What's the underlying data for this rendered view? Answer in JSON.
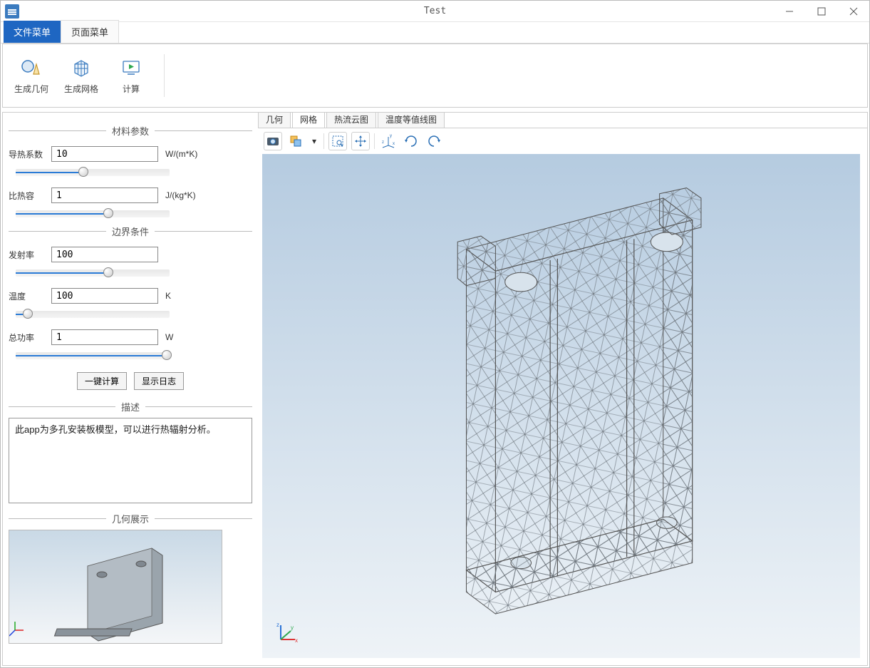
{
  "titlebar": {
    "title": "Test"
  },
  "ribbon": {
    "tabs": [
      {
        "label": "文件菜单",
        "active": true
      },
      {
        "label": "页面菜单",
        "active": false
      }
    ],
    "buttons": {
      "gen_geometry": "生成几何",
      "gen_mesh": "生成网格",
      "compute": "计算"
    }
  },
  "sidebar": {
    "sections": {
      "material": "材料参数",
      "boundary": "边界条件",
      "description": "描述",
      "preview": "几何展示"
    },
    "params": {
      "thermal_conductivity": {
        "label": "导热系数",
        "value": "10",
        "unit": "W/(m*K)",
        "slider_pct": 44
      },
      "specific_heat": {
        "label": "比热容",
        "value": "1",
        "unit": "J/(kg*K)",
        "slider_pct": 60
      },
      "emissivity": {
        "label": "发射率",
        "value": "100",
        "unit": "",
        "slider_pct": 60
      },
      "temperature": {
        "label": "温度",
        "value": "100",
        "unit": "K",
        "slider_pct": 8
      },
      "total_power": {
        "label": "总功率",
        "value": "1",
        "unit": "W",
        "slider_pct": 98
      }
    },
    "actions": {
      "one_click_compute": "一键计算",
      "show_log": "显示日志"
    },
    "description_text": "此app为多孔安装板模型，可以进行热辐射分析。"
  },
  "viewport": {
    "tabs": [
      {
        "label": "几何"
      },
      {
        "label": "网格",
        "active": true
      },
      {
        "label": "热流云图"
      },
      {
        "label": "温度等值线图"
      }
    ],
    "toolbar_icons": [
      "camera-icon",
      "box-select-icon",
      "dropdown-icon",
      "zoom-box-icon",
      "pan-all-icon",
      "axes-xyz-icon",
      "rotate-cw-icon",
      "rotate-ccw-icon"
    ]
  }
}
